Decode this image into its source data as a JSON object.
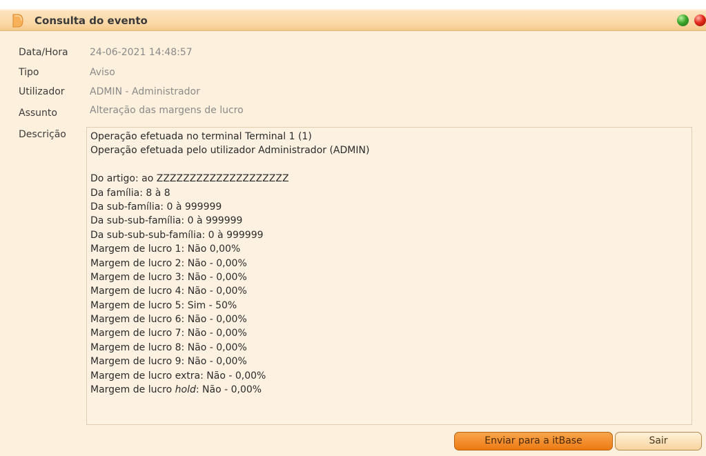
{
  "window": {
    "title": "Consulta do evento",
    "icons": {
      "title": "document-icon",
      "green": "green-circle-icon",
      "red": "red-circle-icon"
    }
  },
  "fields": {
    "datetime": {
      "label": "Data/Hora",
      "value": "24-06-2021 14:48:57"
    },
    "type": {
      "label": "Tipo",
      "value": "Aviso"
    },
    "user": {
      "label": "Utilizador",
      "value": "ADMIN - Administrador"
    },
    "subject": {
      "label": "Assunto",
      "value": "Alteração das margens de lucro"
    },
    "description_label": "Descrição"
  },
  "description": {
    "lines": [
      "Operação efetuada no terminal Terminal 1 (1)",
      "Operação efetuada pelo utilizador Administrador (ADMIN)",
      "",
      "Do artigo: ao ZZZZZZZZZZZZZZZZZZZZ",
      "Da família: 8 à 8",
      "Da sub-família: 0 à 999999",
      "Da sub-sub-família: 0 à 999999",
      "Da sub-sub-sub-família: 0 à 999999",
      "Margem de lucro 1: Não 0,00%",
      "Margem de lucro 2: Não - 0,00%",
      "Margem de lucro 3: Não - 0,00%",
      "Margem de lucro 4: Não - 0,00%",
      "Margem de lucro 5: Sim - 50%",
      "Margem de lucro 6: Não - 0,00%",
      "Margem de lucro 7: Não - 0,00%",
      "Margem de lucro 8: Não - 0,00%",
      "Margem de lucro 9: Não - 0,00%",
      "Margem de lucro extra: Não - 0,00%"
    ],
    "last_line": {
      "prefix": "Margem de lucro ",
      "italic": "hold",
      "suffix": ": Não - 0,00%"
    }
  },
  "buttons": {
    "send": "Enviar para a itBase",
    "exit": "Sair"
  },
  "colors": {
    "accent": "#ec7a12",
    "background": "#fdf0dc"
  }
}
